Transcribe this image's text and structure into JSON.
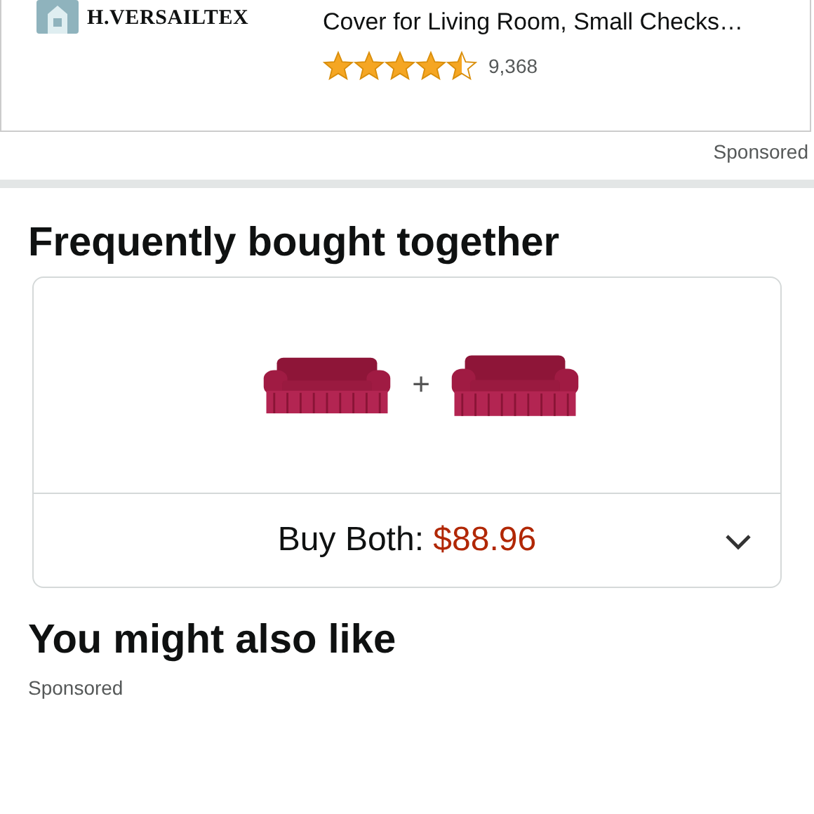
{
  "ad": {
    "brand": "H.VERSAILTEX",
    "title": "Cover for Living Room, Small Checks…",
    "stars": 4.5,
    "rating_count": "9,368",
    "sponsored": "Sponsored"
  },
  "bought_together": {
    "heading": "Frequently bought together",
    "plus": "+",
    "buy_label": "Buy Both: ",
    "price": "$88.96",
    "expanded": false
  },
  "also_like": {
    "heading": "You might also like",
    "sponsored": "Sponsored"
  }
}
